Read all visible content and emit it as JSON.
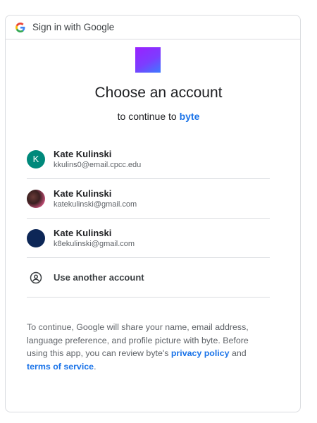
{
  "header": {
    "title": "Sign in with Google"
  },
  "main": {
    "title": "Choose an account",
    "subtitle_prefix": "to continue to ",
    "app_name": "byte"
  },
  "accounts": [
    {
      "name": "Kate Kulinski",
      "email": "kkulins0@email.cpcc.edu",
      "avatar_letter": "K"
    },
    {
      "name": "Kate Kulinski",
      "email": "katekulinski@gmail.com"
    },
    {
      "name": "Kate Kulinski",
      "email": "k8ekulinski@gmail.com"
    }
  ],
  "use_another": {
    "label": "Use another account",
    "icon": "account-circle-icon"
  },
  "disclaimer": {
    "part1": "To continue, Google will share your name, email address, language preference, and profile picture with byte. Before using this app, you can review byte's ",
    "privacy_link": "privacy policy",
    "part2": " and ",
    "terms_link": "terms of service",
    "part3": "."
  },
  "colors": {
    "link": "#1a73e8",
    "border": "#dadce0",
    "avatar_teal": "#00897b",
    "avatar_navy": "#0d2757"
  }
}
